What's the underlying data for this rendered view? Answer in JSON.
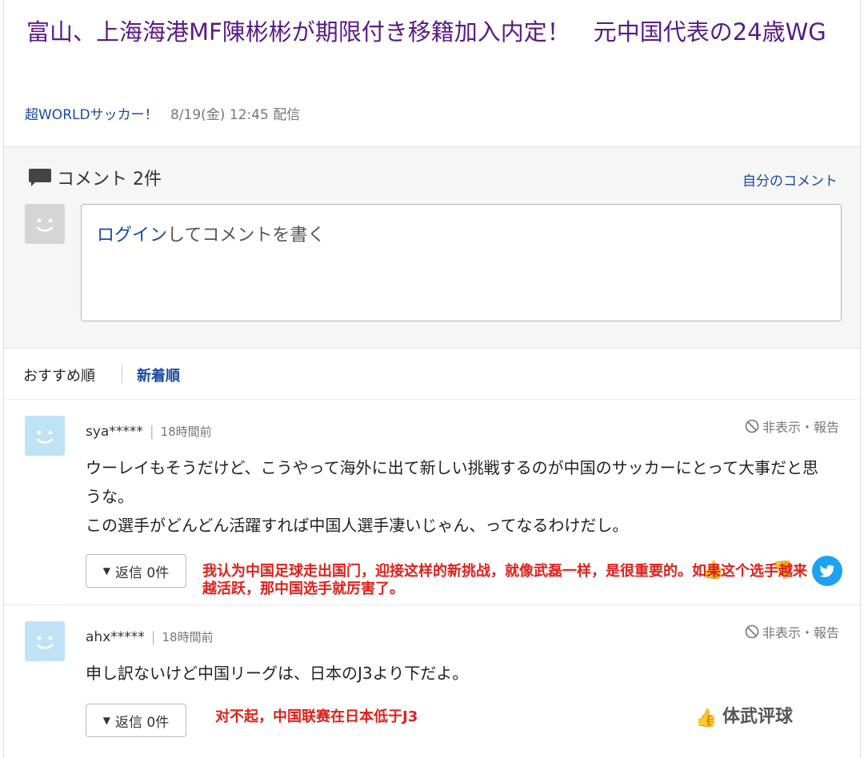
{
  "article": {
    "title": "富山、上海海港MF陳彬彬が期限付き移籍加入内定！　元中国代表の24歳WG",
    "source": "超WORLDサッカー！",
    "datetime": "8/19(金) 12:45 配信"
  },
  "comments_section": {
    "heading": "コメント 2件",
    "my_comments_link": "自分のコメント",
    "input_placeholder_link": "ログイン",
    "input_placeholder_rest": "してコメントを書く"
  },
  "sort": {
    "recommended": "おすすめ順",
    "newest": "新着順"
  },
  "comments": [
    {
      "user": "sya*****",
      "time_ago": "18時間前",
      "hide_report": "非表示・報告",
      "body_lines": [
        "ウーレイもそうだけど、こうやって海外に出て新しい挑戦するのが中国のサッカーにとって大事だと思うな。",
        "この選手がどんどん活躍すれば中国人選手凄いじゃん、ってなるわけだし。"
      ],
      "reply_label": "返信 0件",
      "translation": "我认为中国足球走出国门，迎接这样的新挑战，就像武磊一样，是很重要的。如果这个选手越来越活跃，那中国选手就厉害了。"
    },
    {
      "user": "ahx*****",
      "time_ago": "18時間前",
      "hide_report": "非表示・報告",
      "body_lines": [
        "申し訳ないけど中国リーグは、日本のJ3より下だよ。"
      ],
      "reply_label": "返信 0件",
      "translation": "对不起，中国联赛在日本低于J3",
      "watermark": "体武评球"
    }
  ],
  "colors": {
    "title": "#5a1a87",
    "link": "#1a4aa0",
    "translation": "#e0201b",
    "twitter": "#1da1f2"
  }
}
